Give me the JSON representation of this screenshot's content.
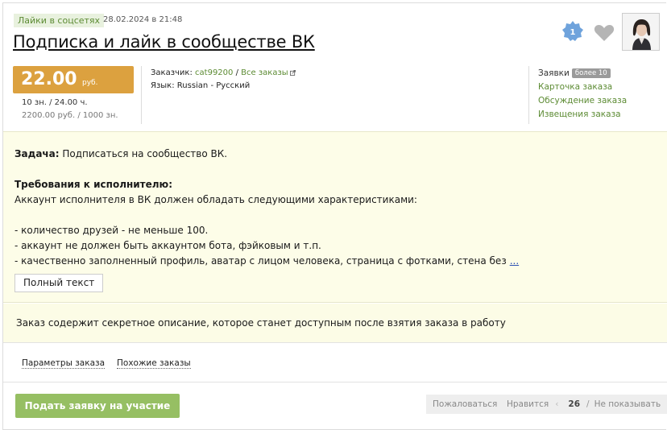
{
  "header": {
    "category": "Лайки в соцсетях",
    "date": "28.02.2024 в 21:48",
    "title": "Подписка и лайк в сообществе ВК",
    "badge_number": "1"
  },
  "price": {
    "value": "22.00",
    "unit": "руб.",
    "line1": "10 зн.  /  24.00 ч.",
    "line2": "2200.00 руб.  /  1000 зн."
  },
  "meta": {
    "customer_label": "Заказчик:",
    "customer_name": "cat99200",
    "separator": "/",
    "all_orders": "Все заказы",
    "language_label": "Язык:",
    "language_value": "Russian - Русский"
  },
  "side": {
    "applications_label": "Заявки",
    "applications_count": "более 10",
    "links": [
      "Карточка заказа",
      "Обсуждение заказа",
      "Извещения заказа"
    ]
  },
  "task": {
    "task_label": "Задача:",
    "task_text": " Подписаться на сообщество ВК.",
    "req_label": "Требования к исполнителю:",
    "req_intro": "Аккаунт исполнителя в ВК должен обладать следующими характеристиками:",
    "items": [
      "- количество друзей - не меньше 100.",
      "- аккаунт не должен быть аккаунтом бота, фэйковым и т.п.",
      "- качественно заполненный профиль, аватар с лицом человека, страница с фотками, стена без"
    ],
    "more": "...",
    "full_text_button": "Полный текст"
  },
  "secret": {
    "text": "Заказ содержит секретное описание, которое станет доступным после взятия заказа в работу"
  },
  "tabs": [
    "Параметры заказа",
    "Похожие заказы"
  ],
  "actions": {
    "apply": "Подать заявку на участие",
    "complain": "Пожаловаться",
    "like": "Нравится",
    "like_count": "26",
    "hide": "Не показывать"
  },
  "colors": {
    "accent_green": "#5c8b33",
    "price_orange": "#dca13f",
    "apply_green": "#96bf63",
    "task_bg": "#fdfde8",
    "badge_blue": "#6fa3dc"
  }
}
